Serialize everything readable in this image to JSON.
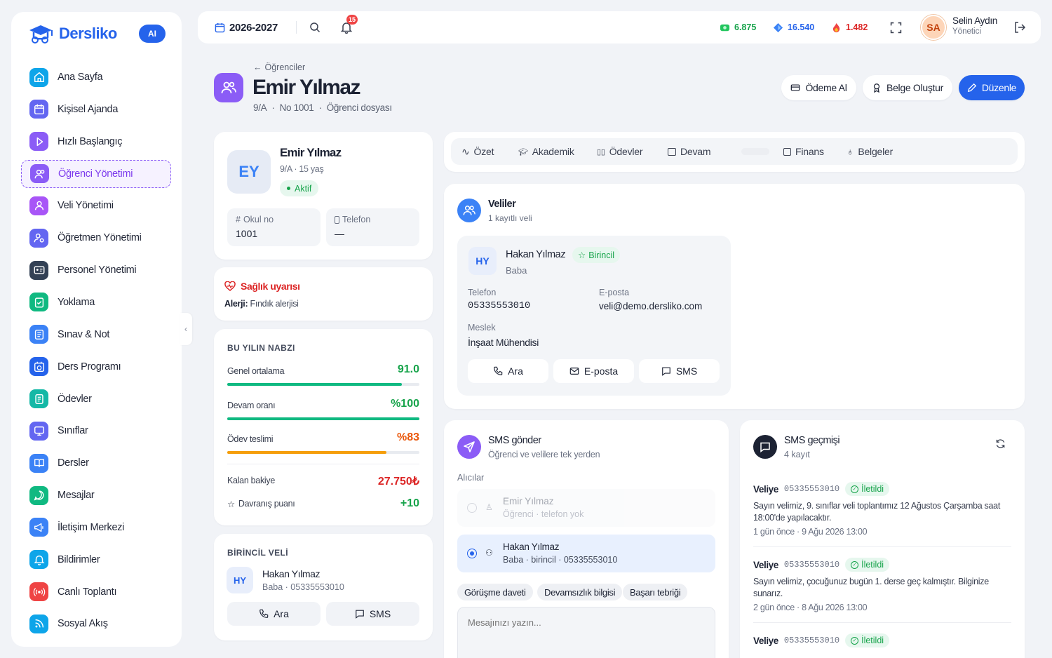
{
  "app": {
    "name": "Dersliko",
    "ai_label": "AI"
  },
  "sidebar": {
    "items": [
      {
        "label": "Ana Sayfa",
        "icon": "home-icon",
        "color": "#0ea5e9"
      },
      {
        "label": "Kişisel Ajanda",
        "icon": "calendar-icon",
        "color": "#6366f1"
      },
      {
        "label": "Hızlı Başlangıç",
        "icon": "play-icon",
        "color": "#8b5cf6"
      },
      {
        "label": "Öğrenci Yönetimi",
        "icon": "students-icon",
        "color": "#8b5cf6",
        "active": true
      },
      {
        "label": "Veli Yönetimi",
        "icon": "parents-icon",
        "color": "#a855f7"
      },
      {
        "label": "Öğretmen Yönetimi",
        "icon": "teacher-icon",
        "color": "#6366f1"
      },
      {
        "label": "Personel Yönetimi",
        "icon": "id-card-icon",
        "color": "#334155"
      },
      {
        "label": "Yoklama",
        "icon": "clipboard-check-icon",
        "color": "#10b981"
      },
      {
        "label": "Sınav & Not",
        "icon": "exam-icon",
        "color": "#3b82f6"
      },
      {
        "label": "Ders Programı",
        "icon": "schedule-icon",
        "color": "#2563eb"
      },
      {
        "label": "Ödevler",
        "icon": "homework-icon",
        "color": "#14b8a6"
      },
      {
        "label": "Sınıflar",
        "icon": "classroom-icon",
        "color": "#6366f1"
      },
      {
        "label": "Dersler",
        "icon": "book-icon",
        "color": "#3b82f6"
      },
      {
        "label": "Mesajlar",
        "icon": "message-icon",
        "color": "#10b981"
      },
      {
        "label": "İletişim Merkezi",
        "icon": "megaphone-icon",
        "color": "#3b82f6"
      },
      {
        "label": "Bildirimler",
        "icon": "bell-icon",
        "color": "#0ea5e9"
      },
      {
        "label": "Canlı Toplantı",
        "icon": "broadcast-icon",
        "color": "#ef4444"
      },
      {
        "label": "Sosyal Akış",
        "icon": "rss-icon",
        "color": "#0ea5e9"
      }
    ]
  },
  "topbar": {
    "year": "2026-2027",
    "notif_count": "15",
    "stat1": "6.875",
    "stat2": "16.540",
    "stat3": "1.482",
    "user_initials": "SA",
    "user_name": "Selin Aydın",
    "user_role": "Yönetici"
  },
  "header": {
    "breadcrumb": "Öğrenciler",
    "title": "Emir Yılmaz",
    "sub_class": "9/A",
    "sub_no": "No 1001",
    "sub_file": "Öğrenci dosyası",
    "btn_payment": "Ödeme Al",
    "btn_document": "Belge Oluştur",
    "btn_edit": "Düzenle"
  },
  "profile": {
    "initials": "EY",
    "name": "Emir Yılmaz",
    "meta": "9/A · 15 yaş",
    "status": "Aktif",
    "school_no_label": "Okul no",
    "school_no": "1001",
    "phone_label": "Telefon",
    "phone": "—"
  },
  "health": {
    "title": "Sağlık uyarısı",
    "label": "Alerji:",
    "value": "Fındık alerjisi"
  },
  "pulse": {
    "title": "BU YILIN NABZI",
    "rows": [
      {
        "label": "Genel ortalama",
        "value": "91.0",
        "pct": 91,
        "color": "#10b981",
        "vcolor": "#16a34a"
      },
      {
        "label": "Devam oranı",
        "value": "%100",
        "pct": 100,
        "color": "#10b981",
        "vcolor": "#16a34a"
      },
      {
        "label": "Ödev teslimi",
        "value": "%83",
        "pct": 83,
        "color": "#f59e0b",
        "vcolor": "#ea580c"
      }
    ],
    "balance_label": "Kalan bakiye",
    "balance": "27.750₺",
    "behavior_label": "Davranış puanı",
    "behavior": "+10"
  },
  "primary_parent": {
    "title": "BİRİNCİL VELİ",
    "initials": "HY",
    "name": "Hakan Yılmaz",
    "meta": "Baba · 05335553010",
    "call": "Ara",
    "sms": "SMS"
  },
  "tabs": [
    "Özet",
    "Akademik",
    "Ödevler",
    "Devam",
    "Finans",
    "Belgeler"
  ],
  "parents": {
    "title": "Veliler",
    "subtitle": "1 kayıtlı veli",
    "initials": "HY",
    "name": "Hakan Yılmaz",
    "badge": "Birincil",
    "relation": "Baba",
    "phone_label": "Telefon",
    "phone": "05335553010",
    "email_label": "E-posta",
    "email": "veli@demo.dersliko.com",
    "job_label": "Meslek",
    "job": "İnşaat Mühendisi",
    "call": "Ara",
    "email_btn": "E-posta",
    "sms": "SMS"
  },
  "sms_send": {
    "title": "SMS gönder",
    "subtitle": "Öğrenci ve velilere tek yerden",
    "recipients_label": "Alıcılar",
    "r1_name": "Emir Yılmaz",
    "r1_meta": "Öğrenci · telefon yok",
    "r2_name": "Hakan Yılmaz",
    "r2_meta": "Baba · birincil · 05335553010",
    "templates": [
      "Görüşme daveti",
      "Devamsızlık bilgisi",
      "Başarı tebriği"
    ],
    "placeholder": "Mesajınızı yazın..."
  },
  "sms_history": {
    "title": "SMS geçmişi",
    "subtitle": "4 kayıt",
    "items": [
      {
        "to": "Veliye",
        "phone": "05335553010",
        "status": "İletildi",
        "text": "Sayın velimiz, 9. sınıflar veli toplantımız 12 Ağustos Çarşamba saat 18:00'de yapılacaktır.",
        "time": "1 gün önce · 9 Ağu 2026 13:00"
      },
      {
        "to": "Veliye",
        "phone": "05335553010",
        "status": "İletildi",
        "text": "Sayın velimiz, çocuğunuz bugün 1. derse geç kalmıştır. Bilginize sunarız.",
        "time": "2 gün önce · 8 Ağu 2026 13:00"
      },
      {
        "to": "Veliye",
        "phone": "05335553010",
        "status": "İletildi",
        "text": "",
        "time": ""
      }
    ]
  }
}
